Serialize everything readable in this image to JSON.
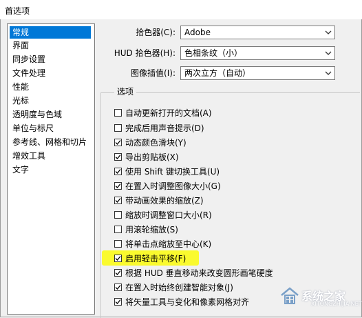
{
  "window": {
    "title": "首选项"
  },
  "sidebar": {
    "items": [
      {
        "label": "常规",
        "selected": true
      },
      {
        "label": "界面"
      },
      {
        "label": "同步设置"
      },
      {
        "label": "文件处理"
      },
      {
        "label": "性能"
      },
      {
        "label": "光标"
      },
      {
        "label": "透明度与色域"
      },
      {
        "label": "单位与标尺"
      },
      {
        "label": "参考线、网格和切片"
      },
      {
        "label": "增效工具"
      },
      {
        "label": "文字"
      }
    ]
  },
  "fields": {
    "color_picker": {
      "label": "拾色器(C):",
      "value": "Adobe"
    },
    "hud_color_picker": {
      "label": "HUD 拾色器(H):",
      "value": "色相条纹（小）"
    },
    "image_interpolation": {
      "label": "图像插值(I):",
      "value": "两次立方（自动）"
    }
  },
  "options": {
    "title": "选项",
    "items": [
      {
        "label": "自动更新打开的文档(A)",
        "checked": false
      },
      {
        "label": "完成后用声音提示(D)",
        "checked": false
      },
      {
        "label": "动态颜色滑块(Y)",
        "checked": true
      },
      {
        "label": "导出剪贴板(X)",
        "checked": true
      },
      {
        "label": "使用 Shift 键切换工具(U)",
        "checked": true
      },
      {
        "label": "在置入时调整图像大小(G)",
        "checked": true
      },
      {
        "label": "带动画效果的缩放(Z)",
        "checked": true
      },
      {
        "label": "缩放时调整窗口大小(R)",
        "checked": false
      },
      {
        "label": "用滚轮缩放(S)",
        "checked": false
      },
      {
        "label": "将单击点缩放至中心(K)",
        "checked": false
      },
      {
        "label": "启用轻击平移(F)",
        "checked": true,
        "highlighted": true
      },
      {
        "label": "根据 HUD 垂直移动来改变圆形画笔硬度",
        "checked": true
      },
      {
        "label": "在置入时始终创建智能对象(J)",
        "checked": true
      },
      {
        "label": "将矢量工具与变化和像素网格对齐",
        "checked": true
      }
    ]
  },
  "watermark": {
    "text": "系统之家",
    "url": "XITONGZHIJIA.NET",
    "icon": "house-logo-icon"
  },
  "colors": {
    "selection": "#0078d7",
    "highlight": "#fafa2e"
  }
}
